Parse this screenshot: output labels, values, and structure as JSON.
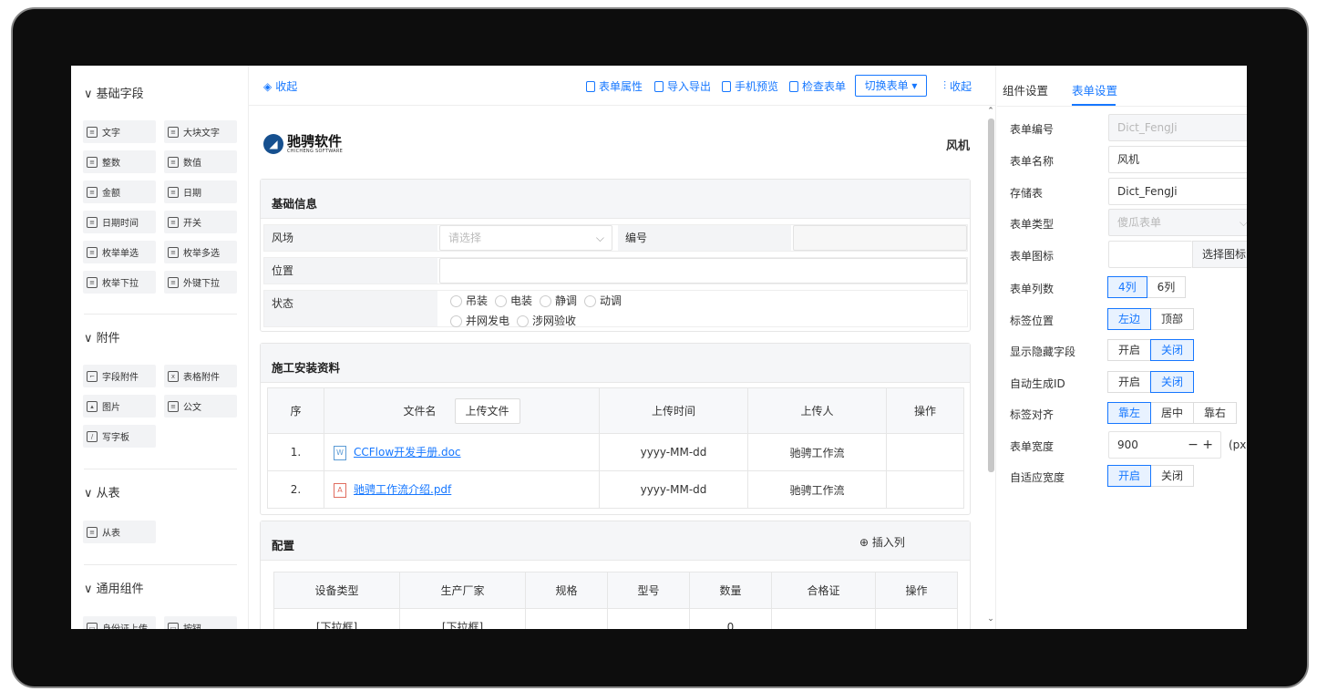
{
  "palette": {
    "basic": {
      "title": "基础字段",
      "items": [
        "文字",
        "大块文字",
        "整数",
        "数值",
        "金额",
        "日期",
        "日期时间",
        "开关",
        "枚举单选",
        "枚举多选",
        "枚举下拉",
        "外键下拉"
      ],
      "icons": [
        "text-icon",
        "textarea-icon",
        "integer-icon",
        "number-icon",
        "money-icon",
        "date-icon",
        "datetime-icon",
        "switch-icon",
        "radio-icon",
        "checkbox-icon",
        "dropdown-icon",
        "foreign-key-icon"
      ]
    },
    "attach": {
      "title": "附件",
      "items": [
        "字段附件",
        "表格附件",
        "图片",
        "公文",
        "写字板"
      ]
    },
    "sub": {
      "title": "从表",
      "items": [
        "从表"
      ]
    },
    "common": {
      "title": "通用组件",
      "items": [
        "身份证上传",
        "按钮"
      ]
    }
  },
  "toolbar": {
    "collapse_left": "收起",
    "form_props": "表单属性",
    "import_export": "导入导出",
    "mobile_preview": "手机预览",
    "check_form": "检查表单",
    "switch_form": "切换表单",
    "collapse_right": "收起"
  },
  "header": {
    "logo_cn": "驰骋软件",
    "logo_en": "CHICHENG SOFTWARE",
    "form_title": "风机"
  },
  "basic_info": {
    "title": "基础信息",
    "wind_farm_label": "风场",
    "wind_farm_placeholder": "请选择",
    "code_label": "编号",
    "location_label": "位置",
    "status_label": "状态",
    "status_options": [
      "吊装",
      "电装",
      "静调",
      "动调",
      "并网发电",
      "涉网验收"
    ]
  },
  "install": {
    "title": "施工安装资料",
    "headers": {
      "seq": "序",
      "filename": "文件名",
      "upload_btn": "上传文件",
      "time": "上传时间",
      "uploader": "上传人",
      "ops": "操作"
    },
    "rows": [
      {
        "seq": "1.",
        "file": "CCFlow开发手册.doc",
        "time": "yyyy-MM-dd",
        "uploader": "驰骋工作流"
      },
      {
        "seq": "2.",
        "file": "驰骋工作流介绍.pdf",
        "time": "yyyy-MM-dd",
        "uploader": "驰骋工作流"
      }
    ]
  },
  "config": {
    "title": "配置",
    "insert_col": "插入列",
    "headers": [
      "设备类型",
      "生产厂家",
      "规格",
      "型号",
      "数量",
      "合格证",
      "操作"
    ],
    "row": [
      "[下拉框]",
      "[下拉框]",
      "",
      "",
      "0",
      "",
      ""
    ]
  },
  "props": {
    "tab_component": "组件设置",
    "tab_form": "表单设置",
    "form_no_label": "表单编号",
    "form_no": "Dict_FengJi",
    "form_name_label": "表单名称",
    "form_name": "风机",
    "table_label": "存储表",
    "table": "Dict_FengJi",
    "form_type_label": "表单类型",
    "form_type": "傻瓜表单",
    "form_icon_label": "表单图标",
    "choose_icon": "选择图标",
    "cols_label": "表单列数",
    "cols": [
      "4列",
      "6列"
    ],
    "label_pos_label": "标签位置",
    "label_pos": [
      "左边",
      "顶部"
    ],
    "show_hidden_label": "显示隐藏字段",
    "on_off": [
      "开启",
      "关闭"
    ],
    "auto_id_label": "自动生成ID",
    "align_label": "标签对齐",
    "align": [
      "靠左",
      "居中",
      "靠右"
    ],
    "width_label": "表单宽度",
    "width": "900",
    "width_unit": "(px)",
    "adaptive_label": "自适应宽度"
  }
}
